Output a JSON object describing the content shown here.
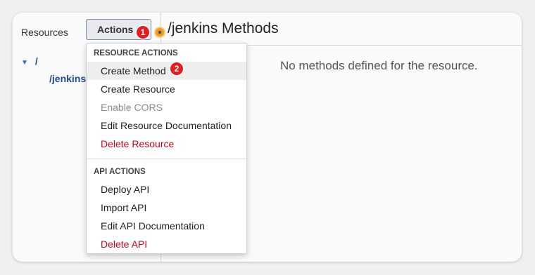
{
  "sidebar": {
    "title": "Resources",
    "actions_label": "Actions",
    "tree_root": "/",
    "tree_child": "/jenkins"
  },
  "header": {
    "title": "/jenkins Methods"
  },
  "main": {
    "empty_message": "No methods defined for the resource."
  },
  "badges": {
    "step1": "1",
    "step2": "2"
  },
  "menu": {
    "resource_section": "RESOURCE ACTIONS",
    "resource_items": [
      "Create Method",
      "Create Resource",
      "Enable CORS",
      "Edit Resource Documentation",
      "Delete Resource"
    ],
    "api_section": "API ACTIONS",
    "api_items": [
      "Deploy API",
      "Import API",
      "Edit API Documentation",
      "Delete API"
    ]
  },
  "colors": {
    "badge": "#e31d1d",
    "danger": "#d0021b",
    "link": "#1e4b9a",
    "marker": "#f39c12"
  }
}
